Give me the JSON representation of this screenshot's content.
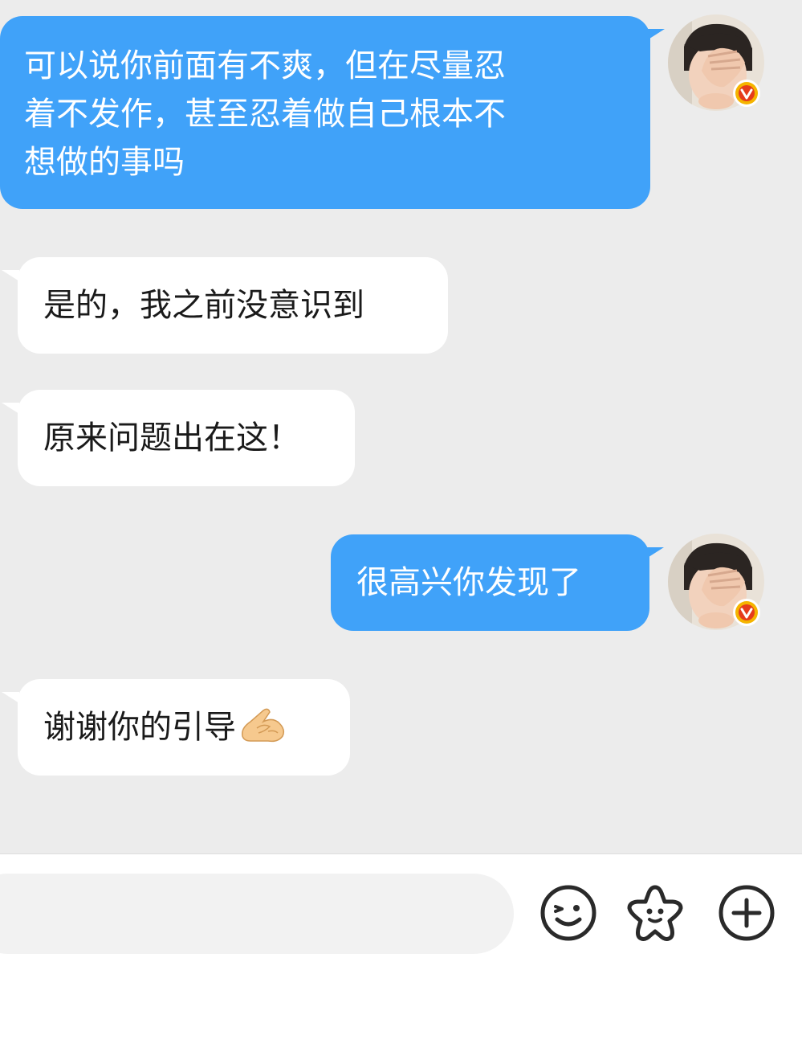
{
  "messages": [
    {
      "side": "out",
      "lines": [
        "可以说你前面有不爽，但在尽量忍",
        "着不发作，甚至忍着做自己根本不",
        "想做的事吗"
      ]
    },
    {
      "side": "in",
      "text": "是的，我之前没意识到"
    },
    {
      "side": "in",
      "text": "原来问题出在这！"
    },
    {
      "side": "out",
      "text": "很高兴你发现了"
    },
    {
      "side": "in",
      "text": "谢谢你的引导",
      "emoji": "🫰"
    }
  ],
  "avatar": {
    "badge": "v",
    "badge_color": "#f5a623"
  },
  "input": {
    "placeholder": ""
  },
  "icons": [
    "emoji-icon",
    "sticker-icon",
    "add-icon"
  ],
  "colors": {
    "outgoing_bubble": "#40a2f9",
    "incoming_bubble": "#ffffff",
    "chat_bg": "#ececec"
  }
}
